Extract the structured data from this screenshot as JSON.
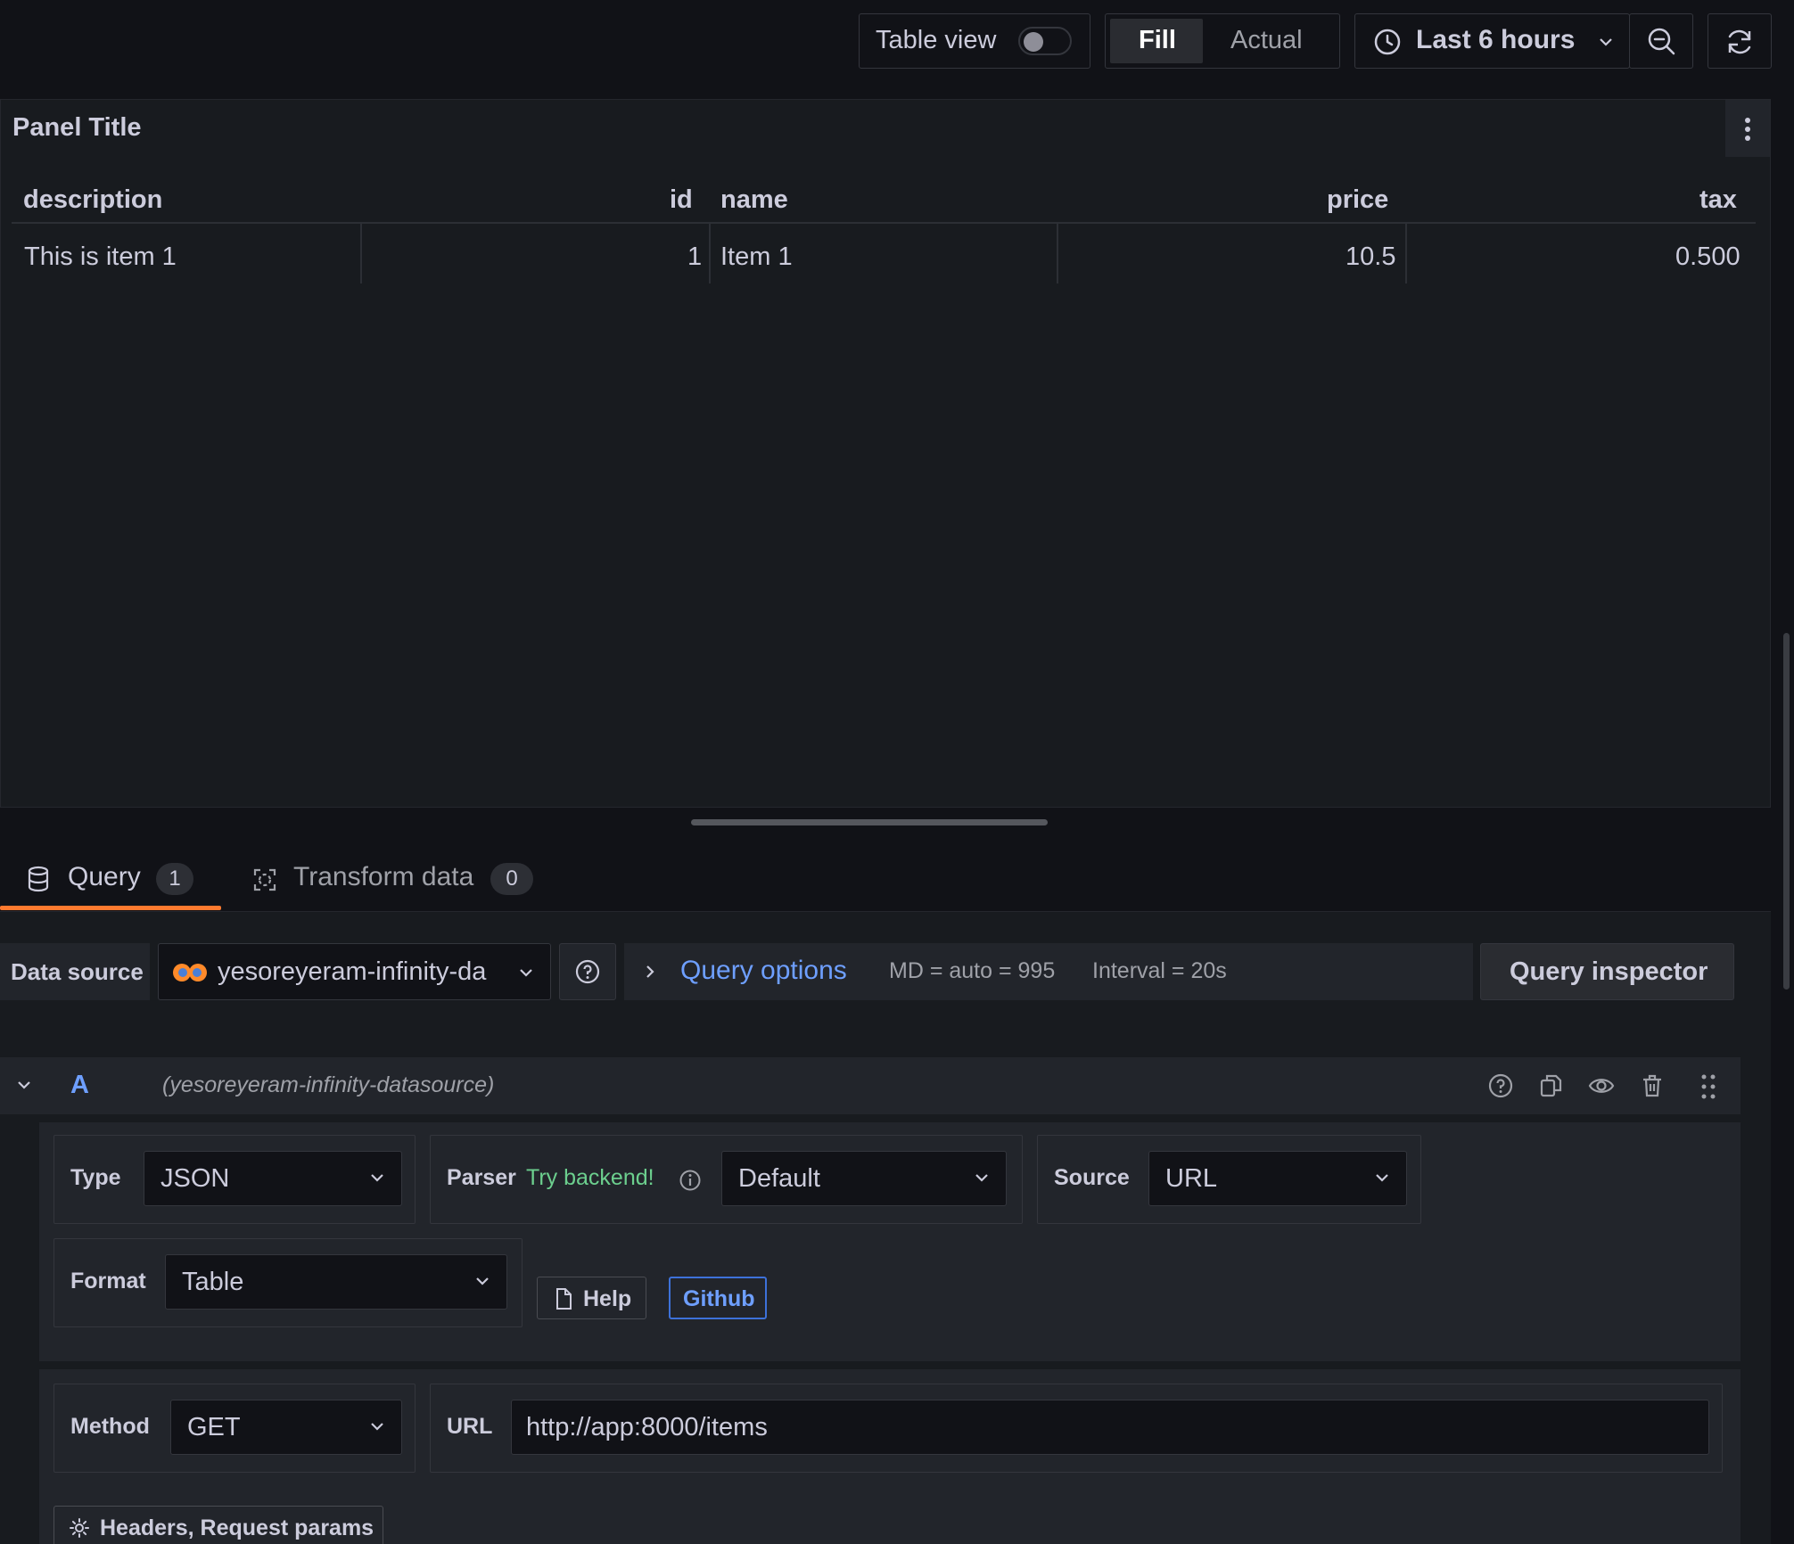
{
  "toolbar": {
    "table_view_label": "Table view",
    "table_view_on": false,
    "fill_label": "Fill",
    "actual_label": "Actual",
    "time_range_label": "Last 6 hours"
  },
  "panel": {
    "title": "Panel Title",
    "columns": [
      "description",
      "id",
      "name",
      "price",
      "tax"
    ],
    "rows": [
      [
        "This is item 1",
        "1",
        "Item 1",
        "10.5",
        "0.500"
      ]
    ]
  },
  "tabs": {
    "query_label": "Query",
    "query_count": "1",
    "transform_label": "Transform data",
    "transform_count": "0"
  },
  "datasource_bar": {
    "label": "Data source",
    "selected": "yesoreyeram-infinity-da",
    "query_options_label": "Query options",
    "md_info": "MD = auto = 995",
    "interval_info": "Interval = 20s",
    "inspector_label": "Query inspector"
  },
  "query_row": {
    "ref_id": "A",
    "datasource_name": "(yesoreyeram-infinity-datasource)"
  },
  "editor": {
    "type_label": "Type",
    "type_value": "JSON",
    "parser_label": "Parser",
    "parser_hint": "Try backend!",
    "parser_value": "Default",
    "source_label": "Source",
    "source_value": "URL",
    "format_label": "Format",
    "format_value": "Table",
    "help_label": "Help",
    "github_label": "Github",
    "method_label": "Method",
    "method_value": "GET",
    "url_label": "URL",
    "url_value": "http://app:8000/items",
    "headers_label": "Headers, Request params"
  },
  "colors": {
    "accent_orange": "#ff7a2f",
    "link_blue": "#6e9fff",
    "success_green": "#6ccf8e"
  }
}
